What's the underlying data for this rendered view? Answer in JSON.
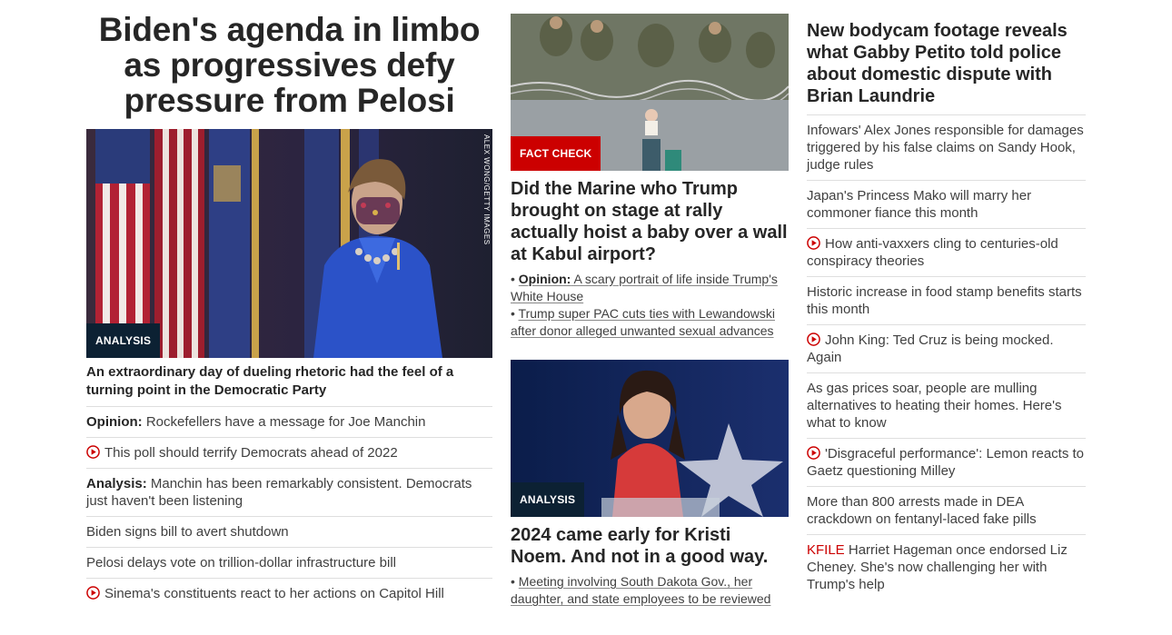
{
  "left": {
    "headline": "Biden's agenda in limbo as progressives defy pressure from Pelosi",
    "image_badge": "ANALYSIS",
    "image_credit": "ALEX WONG/GETTY IMAGES",
    "story_title": "An extraordinary day of dueling rhetoric had the feel of a turning point in the Democratic Party",
    "items": [
      {
        "prefix": "Opinion:",
        "text": "Rockefellers have a message for Joe Manchin",
        "video": false
      },
      {
        "prefix": "",
        "text": "This poll should terrify Democrats ahead of 2022",
        "video": true
      },
      {
        "prefix": "Analysis:",
        "text": "Manchin has been remarkably consistent. Democrats just haven't been listening",
        "video": false
      },
      {
        "prefix": "",
        "text": "Biden signs bill to avert shutdown",
        "video": false
      },
      {
        "prefix": "",
        "text": "Pelosi delays vote on trillion-dollar infrastructure bill",
        "video": false
      },
      {
        "prefix": "",
        "text": "Sinema's constituents react to her actions on Capitol Hill",
        "video": true
      }
    ]
  },
  "middle": {
    "story1": {
      "badge": "FACT CHECK",
      "title": "Did the Marine who Trump brought on stage at rally actually hoist a baby over a wall at Kabul airport?",
      "bullet1_prefix": "Opinion:",
      "bullet1_text": "A scary portrait of life inside Trump's White House",
      "bullet2_text": "Trump super PAC cuts ties with Lewandowski after donor alleged unwanted sexual advances"
    },
    "story2": {
      "badge": "ANALYSIS",
      "title": "2024 came early for Kristi Noem. And not in a good way.",
      "bullet1_text": "Meeting involving South Dakota Gov., her daughter, and state employees to be reviewed"
    }
  },
  "right": {
    "headline": "New bodycam footage reveals what Gabby Petito told police about domestic dispute with Brian Laundrie",
    "items": [
      {
        "prefix": "",
        "text": "Infowars' Alex Jones responsible for damages triggered by his false claims on Sandy Hook, judge rules",
        "video": false
      },
      {
        "prefix": "",
        "text": "Japan's Princess Mako will marry her commoner fiance this month",
        "video": false
      },
      {
        "prefix": "",
        "text": "How anti-vaxxers cling to centuries-old conspiracy theories",
        "video": true
      },
      {
        "prefix": "",
        "text": "Historic increase in food stamp benefits starts this month",
        "video": false
      },
      {
        "prefix": "",
        "text": "John King: Ted Cruz is being mocked. Again",
        "video": true
      },
      {
        "prefix": "",
        "text": "As gas prices soar, people are mulling alternatives to heating their homes. Here's what to know",
        "video": false
      },
      {
        "prefix": "",
        "text": "'Disgraceful performance': Lemon reacts to Gaetz questioning Milley",
        "video": true
      },
      {
        "prefix": "",
        "text": "More than 800 arrests made in DEA crackdown on fentanyl-laced fake pills",
        "video": false
      },
      {
        "prefix": "KFILE",
        "text": "Harriet Hageman once endorsed Liz Cheney. She's now challenging her with Trump's help",
        "video": false
      }
    ]
  },
  "colors": {
    "accent_red": "#cc0000",
    "badge_dark": "#0c2133"
  }
}
